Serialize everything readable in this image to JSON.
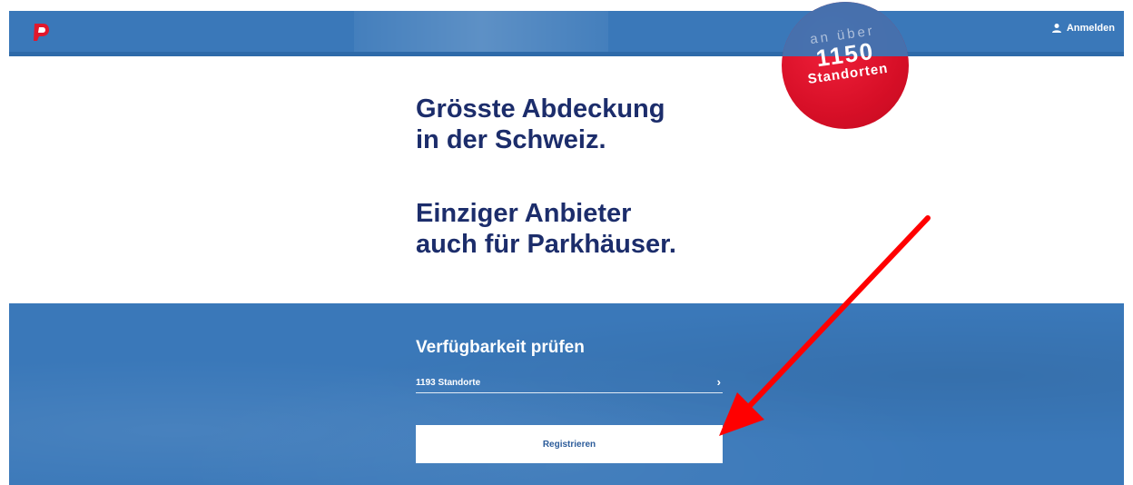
{
  "header": {
    "login_label": "Anmelden"
  },
  "badge": {
    "line1": "an über",
    "line2": "1150",
    "line3": "Standorten"
  },
  "headlines": {
    "coverage_line1": "Grösste Abdeckung",
    "coverage_line2": "in der Schweiz.",
    "provider_line1": "Einziger Anbieter",
    "provider_line2": "auch für Parkhäuser."
  },
  "availability": {
    "title": "Verfügbarkeit prüfen",
    "location_value": "1193 Standorte",
    "chevron_icon": "chevron-right-icon",
    "register_label": "Registrieren"
  },
  "colors": {
    "brand_blue": "#3a78b9",
    "headline_navy": "#1c2d6b",
    "badge_red": "#d70f27",
    "annotation_red": "#ff0000"
  }
}
